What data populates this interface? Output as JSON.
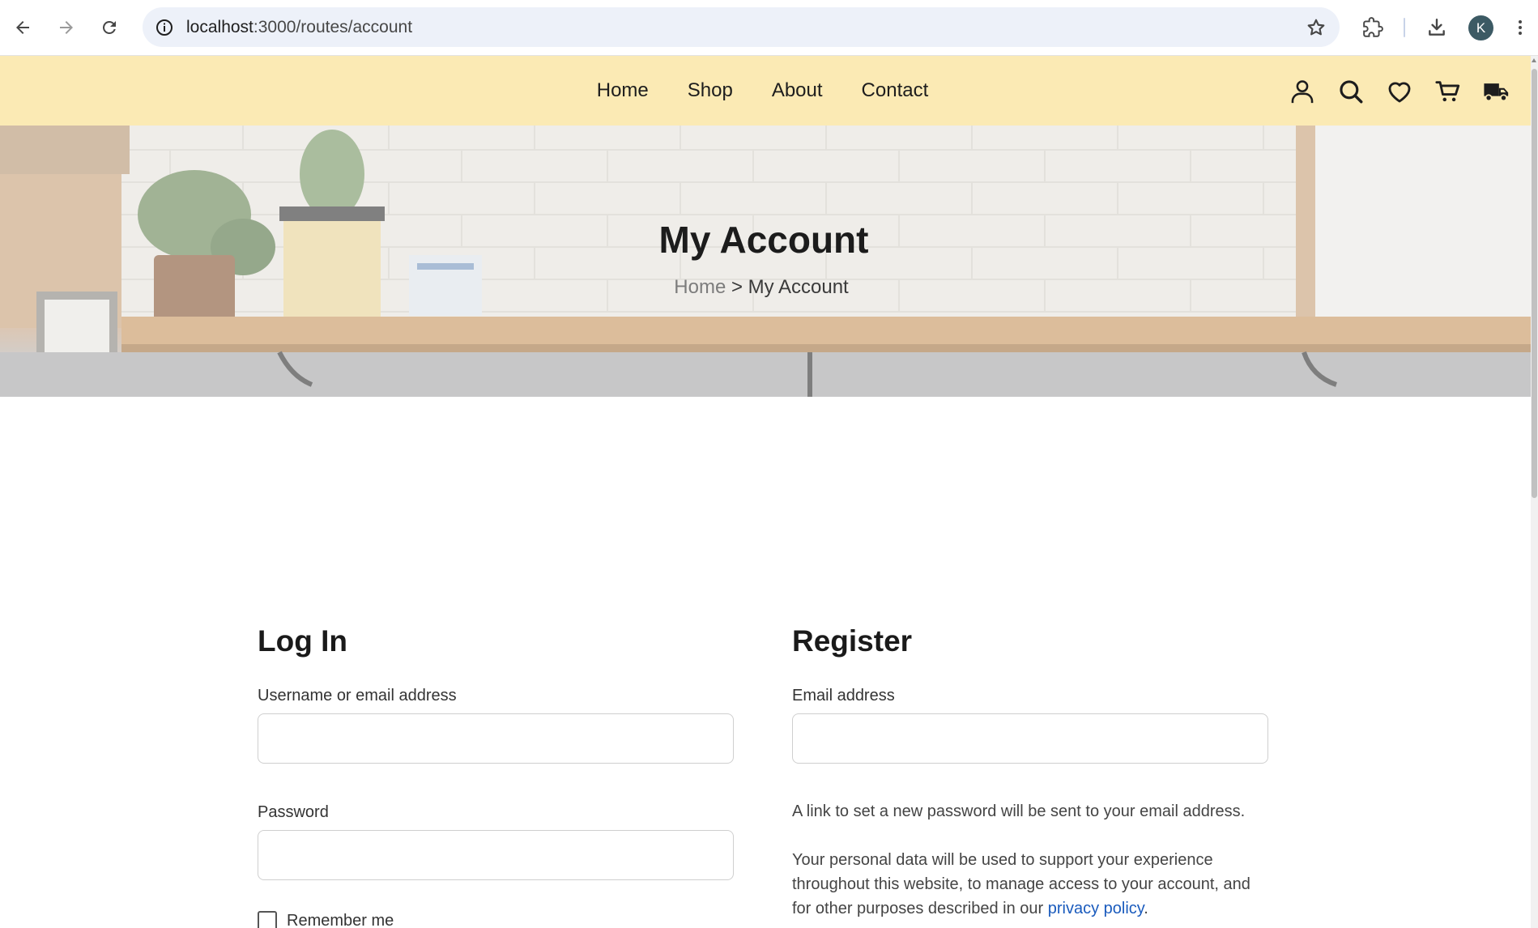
{
  "browser": {
    "url_host": "localhost",
    "url_path": ":3000/routes/account",
    "profile_initial": "K"
  },
  "header": {
    "nav": [
      {
        "label": "Home"
      },
      {
        "label": "Shop"
      },
      {
        "label": "About"
      },
      {
        "label": "Contact"
      }
    ],
    "icons": [
      "user-icon",
      "search-icon",
      "heart-icon",
      "cart-icon",
      "truck-icon"
    ]
  },
  "hero": {
    "title": "My Account",
    "breadcrumb_home": "Home",
    "breadcrumb_separator": " > ",
    "breadcrumb_current": "My Account"
  },
  "login": {
    "heading": "Log In",
    "username_label": "Username or email address",
    "username_value": "",
    "password_label": "Password",
    "password_value": "",
    "remember_label": "Remember me",
    "remember_checked": false
  },
  "register": {
    "heading": "Register",
    "email_label": "Email address",
    "email_value": "",
    "password_note": "A link to set a new password will be sent to your email address.",
    "privacy_text": "Your personal data will be used to support your experience throughout this website, to manage access to your account, and for other purposes described in our ",
    "privacy_link": "privacy policy",
    "privacy_end": "."
  },
  "colors": {
    "header_bg": "#fbeab4",
    "link": "#1a5bbd"
  }
}
